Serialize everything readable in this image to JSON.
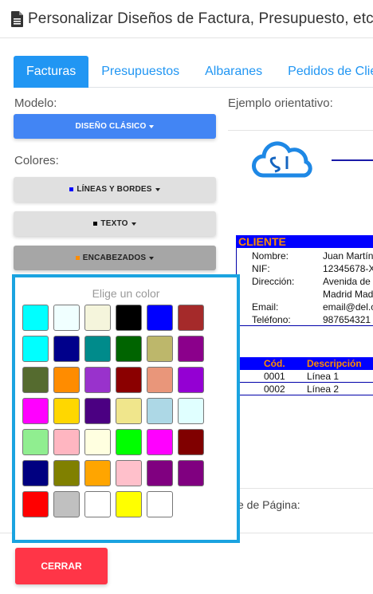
{
  "window": {
    "title": "Personalizar Diseños de Factura, Presupuesto, etc",
    "icon": "document-icon"
  },
  "tabs": [
    {
      "label": "Facturas",
      "active": true
    },
    {
      "label": "Presupuestos",
      "active": false
    },
    {
      "label": "Albaranes",
      "active": false
    },
    {
      "label": "Pedidos de Clie",
      "active": false
    }
  ],
  "left": {
    "modelo_label": "Modelo:",
    "modelo_button": "DISEÑO CLÁSICO",
    "colores_label": "Colores:",
    "lineas_button": "LÍNEAS Y BORDES",
    "texto_button": "TEXTO",
    "encabezados_button": "ENCABEZADOS",
    "lineas_color": "#0000ff",
    "texto_color": "#000000",
    "encabezados_color": "#ff8c00"
  },
  "preview": {
    "label": "Ejemplo orientativo:",
    "logo_icon": "cloud-logo-icon",
    "cliente_header": "CLIENTE",
    "cliente_rows": [
      {
        "key": "Nombre:",
        "value": "Juan Martín"
      },
      {
        "key": "NIF:",
        "value": "12345678-X"
      },
      {
        "key": "Dirección:",
        "value": "Avenida de"
      },
      {
        "key": "",
        "value": "Madrid Mad"
      },
      {
        "key": "Email:",
        "value": "email@del.c"
      },
      {
        "key": "Teléfono:",
        "value": "987654321"
      }
    ],
    "items_header": {
      "cod": "Cód.",
      "desc": "Descripción"
    },
    "items": [
      {
        "cod": "0001",
        "desc": "Línea 1"
      },
      {
        "cod": "0002",
        "desc": "Línea 2"
      }
    ],
    "footer_label": "e de Página:"
  },
  "picker": {
    "title": "Elige un color",
    "colors": [
      "#00ffff",
      "#f0ffff",
      "#f5f5dc",
      "#000000",
      "#0000ff",
      "#a52a2a",
      "#00ffff",
      "#00008b",
      "#008b8b",
      "#006400",
      "#bdb76b",
      "#8b008b",
      "#556b2f",
      "#ff8c00",
      "#9932cc",
      "#8b0000",
      "#e9967a",
      "#9400d3",
      "#ff00ff",
      "#ffd700",
      "#4b0082",
      "#f0e68c",
      "#add8e6",
      "#e0ffff",
      "#90ee90",
      "#ffb6c1",
      "#ffffe0",
      "#00ff00",
      "#ff00ff",
      "#800000",
      "#000080",
      "#808000",
      "#ffa500",
      "#ffc0cb",
      "#800080",
      "#800080",
      "#ff0000",
      "#c0c0c0",
      "#ffffff",
      "#ffff00",
      "#ffffff"
    ]
  },
  "close_button": "CERRAR",
  "colors": {
    "accent": "#2196f3",
    "primary_button": "#4285f4",
    "danger": "#ff3547",
    "picker_border": "#1aa3e0",
    "preview_header": "#0000ff",
    "preview_header_text": "#ff8c00"
  }
}
